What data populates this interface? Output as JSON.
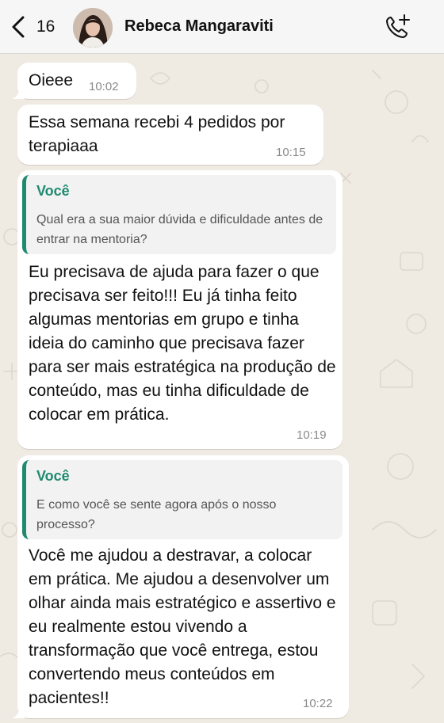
{
  "header": {
    "back_count": "16",
    "contact_name": "Rebeca Mangaraviti"
  },
  "colors": {
    "accent": "#1f8a70",
    "chat_bg": "#efeae2",
    "bubble_bg": "#ffffff",
    "quote_bg": "#f2f2f2"
  },
  "messages": [
    {
      "text": "Oieee",
      "time": "10:02"
    },
    {
      "text": "Essa semana recebi 4 pedidos por terapiaaa",
      "time": "10:15"
    },
    {
      "quote_author": "Você",
      "quote_text": "Qual era a sua maior dúvida e dificuldade antes de entrar na mentoria?",
      "text": "Eu precisava de ajuda para fazer o que precisava ser feito!!!  Eu já tinha feito algumas mentorias em grupo e tinha ideia do caminho que precisava fazer para ser mais estratégica na produção de conteúdo, mas eu tinha dificuldade de colocar em prática.",
      "time": "10:19"
    },
    {
      "quote_author": "Você",
      "quote_text": "E como você se sente agora após o nosso processo?",
      "text": "Você me ajudou a destravar, a colocar em prática. Me ajudou a desenvolver um olhar ainda mais estratégico e assertivo e  eu realmente estou vivendo a transformação que você entrega, estou convertendo meus conteúdos em pacientes!!",
      "time": "10:22"
    }
  ],
  "icons": {
    "back": "chevron-left-icon",
    "call": "phone-add-icon",
    "avatar": "contact-avatar"
  }
}
